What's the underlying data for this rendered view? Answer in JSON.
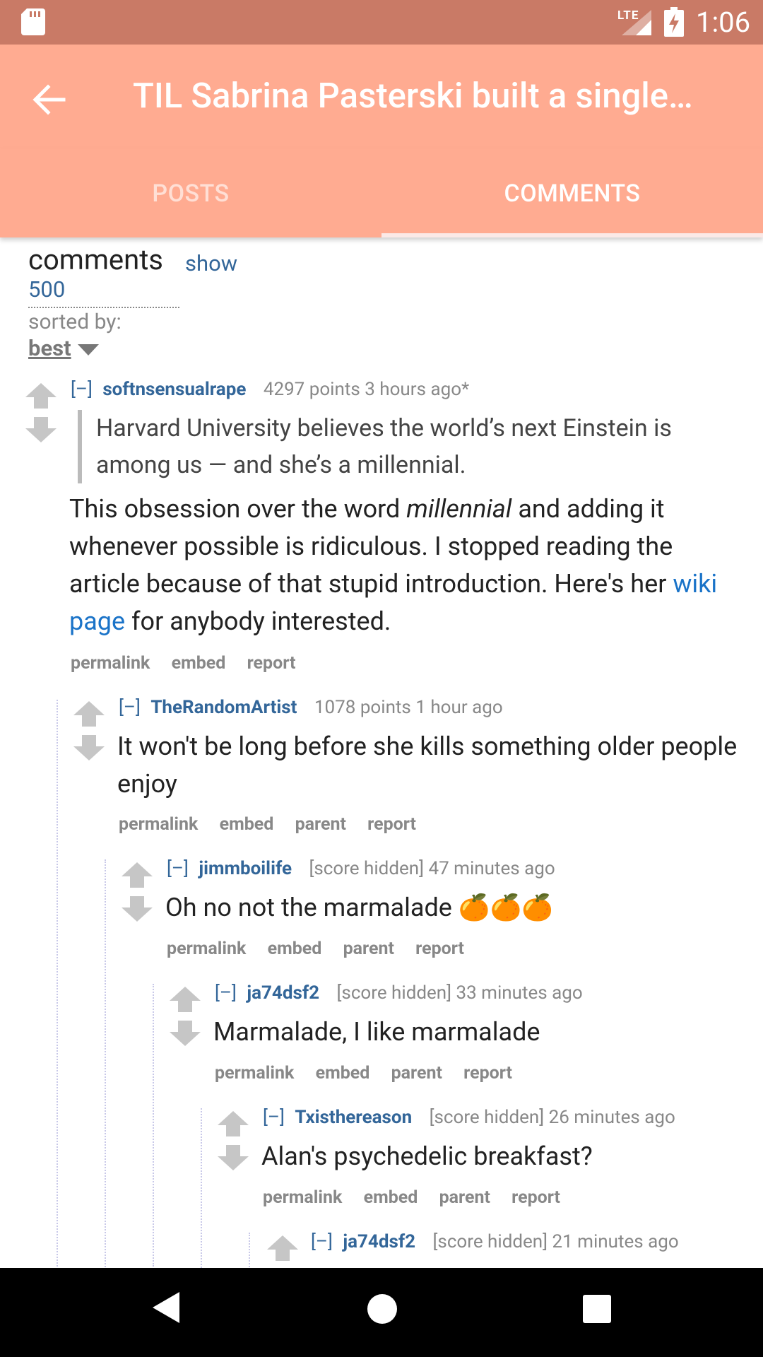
{
  "status_bar": {
    "network": "LTE",
    "time": "1:06"
  },
  "toolbar": {
    "title": "TIL Sabrina Pasterski built a single…"
  },
  "tabs": [
    {
      "label": "POSTS",
      "selected": false
    },
    {
      "label": "COMMENTS",
      "selected": true
    }
  ],
  "header": {
    "comments_label": "comments",
    "show_label": "show",
    "count_option": "500",
    "sorted_by_label": "sorted by:",
    "sort_value": "best"
  },
  "comments": [
    {
      "collapse": "[–]",
      "author": "softnsensualrape",
      "score": "4297 points 3 hours ago*",
      "quote": "Harvard University believes the world’s next Einstein is among us — and she’s a millennial.",
      "body_1": "This obsession over the word ",
      "body_em": "millennial",
      "body_2": " and adding it whenever possible is ridiculous. I stopped reading the article because of that stupid introduction. Here's her ",
      "body_link": "wiki page",
      "body_3": " for anybody interested.",
      "actions": [
        "permalink",
        "embed",
        "report"
      ]
    },
    {
      "collapse": "[–]",
      "author": "TheRandomArtist",
      "score": "1078 points 1 hour ago",
      "body": "It won't be long before she kills something older people enjoy",
      "actions": [
        "permalink",
        "embed",
        "parent",
        "report"
      ]
    },
    {
      "collapse": "[–]",
      "author": "jimmboilife",
      "score": "[score hidden] 47 minutes ago",
      "body": "Oh no not the marmalade 🍊🍊🍊",
      "actions": [
        "permalink",
        "embed",
        "parent",
        "report"
      ]
    },
    {
      "collapse": "[–]",
      "author": "ja74dsf2",
      "score": "[score hidden] 33 minutes ago",
      "body": "Marmalade, I like marmalade",
      "actions": [
        "permalink",
        "embed",
        "parent",
        "report"
      ]
    },
    {
      "collapse": "[–]",
      "author": "Txisthereason",
      "score": "[score hidden] 26 minutes ago",
      "body": "Alan's psychedelic breakfast?",
      "actions": [
        "permalink",
        "embed",
        "parent",
        "report"
      ]
    },
    {
      "collapse": "[–]",
      "author": "ja74dsf2",
      "score": "[score hidden] 21 minutes ago"
    }
  ]
}
